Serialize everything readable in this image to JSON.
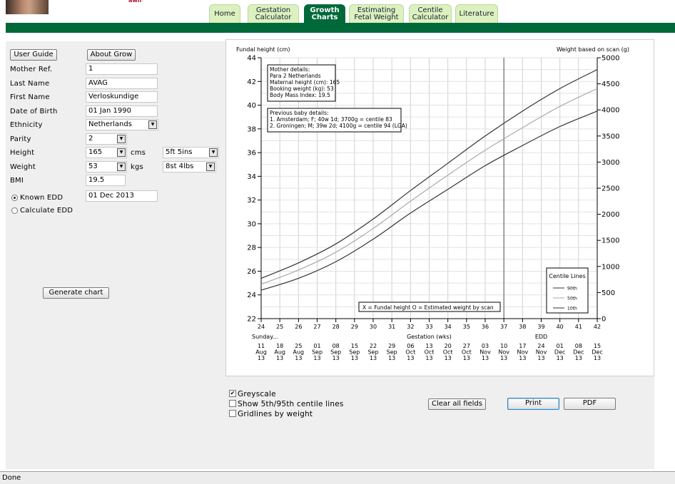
{
  "header": {
    "logo_text": "awh",
    "tabs": [
      {
        "line1": "Home",
        "line2": "",
        "active": false
      },
      {
        "line1": "Gestation",
        "line2": "Calculator",
        "active": false
      },
      {
        "line1": "Growth",
        "line2": "Charts",
        "active": true
      },
      {
        "line1": "Estimating",
        "line2": "Fetal Weight",
        "active": false
      },
      {
        "line1": "Centile",
        "line2": "Calculator",
        "active": false
      },
      {
        "line1": "Literature",
        "line2": "",
        "active": false
      }
    ]
  },
  "form": {
    "user_guide_label": "User Guide",
    "about_grow_label": "About Grow",
    "mother_ref": {
      "label": "Mother Ref.",
      "value": "1"
    },
    "last_name": {
      "label": "Last Name",
      "value": "AVAG"
    },
    "first_name": {
      "label": "First Name",
      "value": "Verloskundige"
    },
    "dob": {
      "label": "Date of Birth",
      "value": "01 Jan 1990"
    },
    "ethnicity": {
      "label": "Ethnicity",
      "value": "Netherlands"
    },
    "parity": {
      "label": "Parity",
      "value": "2"
    },
    "height": {
      "label": "Height",
      "value": "165",
      "unit": "cms",
      "imperial": "5ft 5ins"
    },
    "weight": {
      "label": "Weight",
      "value": "53",
      "unit": "kgs",
      "imperial": "8st 4lbs"
    },
    "bmi": {
      "label": "BMI",
      "value": "19.5"
    },
    "known_edd_label": "Known EDD",
    "known_edd_value": "01 Dec 2013",
    "calculate_edd_label": "Calculate EDD",
    "generate_label": "Generate chart"
  },
  "chart_data": {
    "type": "line",
    "y_left_label": "Fundal height (cm)",
    "y_right_label": "Weight based on scan (g)",
    "xlabel": "Gestation (wks)",
    "xlim": [
      24,
      42
    ],
    "ylim": [
      22,
      44
    ],
    "y_right_lim": [
      0,
      5000
    ],
    "x_ticks": [
      24,
      25,
      26,
      27,
      28,
      29,
      30,
      31,
      32,
      33,
      34,
      35,
      36,
      37,
      38,
      39,
      40,
      41,
      42
    ],
    "y_ticks": [
      22,
      24,
      26,
      28,
      30,
      32,
      34,
      36,
      38,
      40,
      42,
      44
    ],
    "y_right_ticks": [
      0,
      500,
      1000,
      1500,
      2000,
      2500,
      3000,
      3500,
      4000,
      4500,
      5000
    ],
    "edd_week": 37,
    "edd_label": "EDD",
    "sunday_label": "Sunday...",
    "date_rows": [
      [
        "11",
        "18",
        "25",
        "01",
        "08",
        "15",
        "22",
        "29",
        "06",
        "13",
        "20",
        "27",
        "03",
        "10",
        "17",
        "24",
        "01",
        "08",
        "15"
      ],
      [
        "Aug",
        "Aug",
        "Aug",
        "Sep",
        "Sep",
        "Sep",
        "Sep",
        "Sep",
        "Oct",
        "Oct",
        "Oct",
        "Oct",
        "Nov",
        "Nov",
        "Nov",
        "Nov",
        "Dec",
        "Dec",
        "Dec"
      ],
      [
        "13",
        "13",
        "13",
        "13",
        "13",
        "13",
        "13",
        "13",
        "13",
        "13",
        "13",
        "13",
        "13",
        "13",
        "13",
        "13",
        "13",
        "13",
        "13"
      ]
    ],
    "x": [
      24,
      26,
      28,
      30,
      32,
      34,
      36,
      38,
      40,
      42
    ],
    "series": [
      {
        "name": "90th",
        "color": "#333333",
        "values": [
          25.4,
          26.7,
          28.3,
          30.4,
          32.8,
          35.1,
          37.4,
          39.5,
          41.4,
          43.0
        ]
      },
      {
        "name": "50th",
        "color": "#aaaaaa",
        "values": [
          24.9,
          26.1,
          27.6,
          29.6,
          31.9,
          34.1,
          36.2,
          38.1,
          39.9,
          41.4
        ]
      },
      {
        "name": "10th",
        "color": "#333333",
        "values": [
          24.4,
          25.4,
          26.8,
          28.7,
          30.9,
          32.9,
          34.9,
          36.6,
          38.2,
          39.5
        ]
      }
    ],
    "legend_title": "Centile Lines",
    "mother_details": [
      "Mother details:",
      "Para 2  Netherlands",
      "Maternal height (cm): 165",
      "Booking weight (kg): 53",
      "Body Mass Index: 19.5"
    ],
    "previous_baby": [
      "Previous baby details:",
      "1. Amsterdam; F; 40w 1d; 3700g = centile 83",
      "2. Groningen; M; 39w 2d; 4100g = centile 94 (LGA)"
    ],
    "key_text": "X = Fundal height     O = Estimated weight by scan"
  },
  "options": {
    "greyscale_label": "Greyscale",
    "greyscale_checked": true,
    "show_5_95_label": "Show 5th/95th centile lines",
    "show_5_95_checked": false,
    "gridlines_label": "Gridlines by weight",
    "gridlines_checked": false
  },
  "actions": {
    "clear_label": "Clear all fields",
    "print_label": "Print",
    "pdf_label": "PDF"
  },
  "status": {
    "text": "Done"
  }
}
